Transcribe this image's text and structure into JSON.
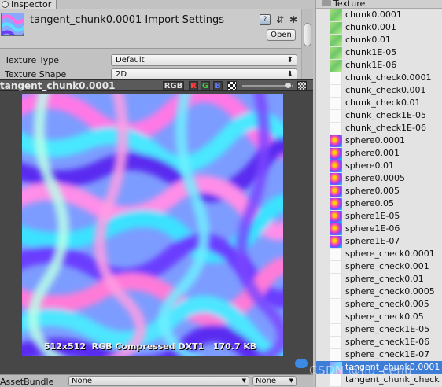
{
  "inspector": {
    "tab_label": "Inspector",
    "title": "tangent_chunk0.0001 Import Settings",
    "open_button": "Open",
    "properties": [
      {
        "label": "Texture Type",
        "value": "Default"
      },
      {
        "label": "Texture Shape",
        "value": "2D"
      }
    ]
  },
  "preview": {
    "name": "tangent_chunk0.0001",
    "channel_buttons": {
      "rgb": "RGB",
      "r": "R",
      "g": "G",
      "b": "B"
    },
    "info": "512x512  RGB Compressed DXT1   170.7 KB",
    "mip_level": 1.0
  },
  "asset_bundle": {
    "label": "AssetBundle",
    "bundle_value": "None",
    "variant_value": "None"
  },
  "project": {
    "folder": "Texture",
    "assets": [
      {
        "name": "chunk0.0001",
        "icon": "chunk-texture-icon"
      },
      {
        "name": "chunk0.001",
        "icon": "chunk-texture-icon"
      },
      {
        "name": "chunk0.01",
        "icon": "chunk-texture-icon"
      },
      {
        "name": "chunk1E-05",
        "icon": "chunk-texture-icon"
      },
      {
        "name": "chunk1E-06",
        "icon": "chunk-texture-icon"
      },
      {
        "name": "chunk_check0.0001",
        "icon": "white-texture-icon"
      },
      {
        "name": "chunk_check0.001",
        "icon": "white-texture-icon"
      },
      {
        "name": "chunk_check0.01",
        "icon": "white-texture-icon"
      },
      {
        "name": "chunk_check1E-05",
        "icon": "white-texture-icon"
      },
      {
        "name": "chunk_check1E-06",
        "icon": "white-texture-icon"
      },
      {
        "name": "sphere0.0001",
        "icon": "sphere-texture-icon"
      },
      {
        "name": "sphere0.001",
        "icon": "sphere-texture-icon"
      },
      {
        "name": "sphere0.01",
        "icon": "sphere-texture-icon"
      },
      {
        "name": "sphere0.0005",
        "icon": "sphere-texture-icon"
      },
      {
        "name": "sphere0.005",
        "icon": "sphere-texture-icon"
      },
      {
        "name": "sphere0.05",
        "icon": "sphere-texture-icon"
      },
      {
        "name": "sphere1E-05",
        "icon": "sphere-texture-icon"
      },
      {
        "name": "sphere1E-06",
        "icon": "sphere-texture-icon"
      },
      {
        "name": "sphere1E-07",
        "icon": "sphere-texture-icon"
      },
      {
        "name": "sphere_check0.0001",
        "icon": "white-texture-icon"
      },
      {
        "name": "sphere_check0.001",
        "icon": "white-texture-icon"
      },
      {
        "name": "sphere_check0.01",
        "icon": "white-texture-icon"
      },
      {
        "name": "sphere_check0.0005",
        "icon": "white-texture-icon"
      },
      {
        "name": "sphere_check0.005",
        "icon": "white-texture-icon"
      },
      {
        "name": "sphere_check0.05",
        "icon": "white-texture-icon"
      },
      {
        "name": "sphere_check1E-05",
        "icon": "white-texture-icon"
      },
      {
        "name": "sphere_check1E-06",
        "icon": "white-texture-icon"
      },
      {
        "name": "sphere_check1E-07",
        "icon": "white-texture-icon"
      },
      {
        "name": "tangent_chunk0.0001",
        "icon": "tangent-texture-icon",
        "selected": true
      },
      {
        "name": "tangent_chunk_check",
        "icon": "white-texture-icon"
      }
    ]
  },
  "watermark": "CSDN @jiu_ceng"
}
